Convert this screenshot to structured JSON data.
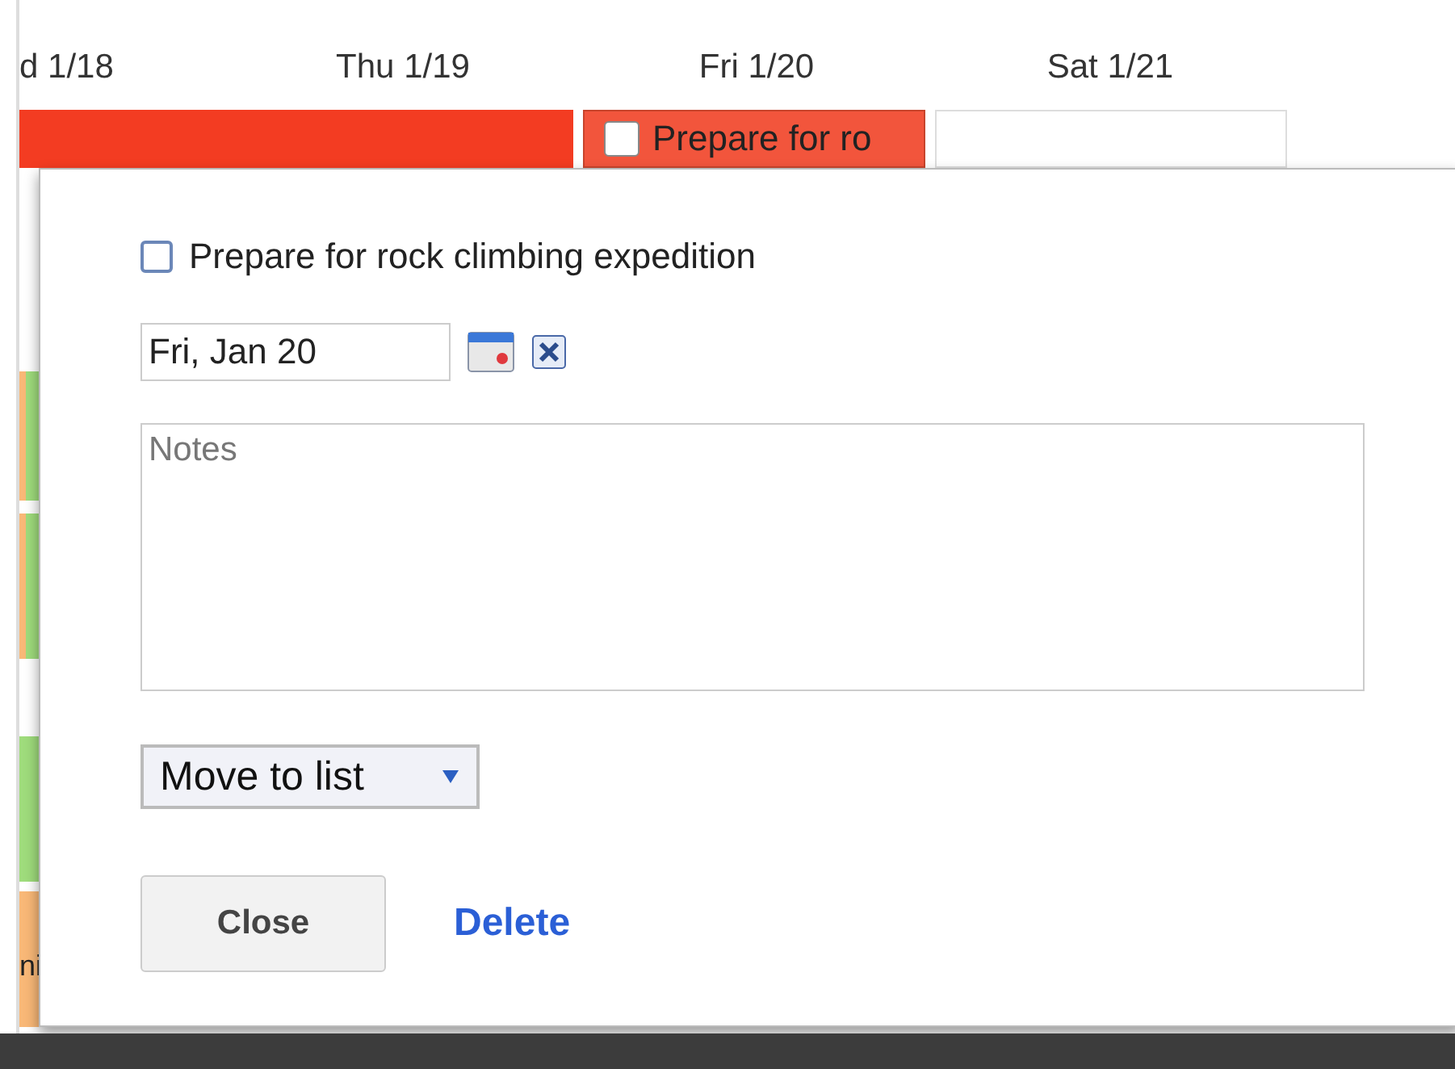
{
  "calendar": {
    "day_headers": [
      "d 1/18",
      "Thu 1/19",
      "Fri 1/20",
      "Sat 1/21"
    ],
    "span_event": {
      "color": "#f33c22"
    },
    "event_chip": {
      "title": "Prepare for ro",
      "checked": false,
      "color": "#f2553c"
    },
    "side_events": [
      {
        "color": "#9fdc7c"
      },
      {
        "color": "#9fdc7c"
      },
      {
        "color": "#9fdc7c"
      },
      {
        "color": "#f9b877"
      }
    ],
    "side_text": "ni"
  },
  "task_popup": {
    "checked": false,
    "title": "Prepare for rock climbing expedition",
    "due_date": "Fri, Jan 20",
    "notes": {
      "placeholder": "Notes"
    },
    "move_menu": "Move to list",
    "buttons": [
      {
        "label": "Close",
        "kind": "button"
      },
      {
        "label": "Delete",
        "kind": "link"
      }
    ]
  }
}
